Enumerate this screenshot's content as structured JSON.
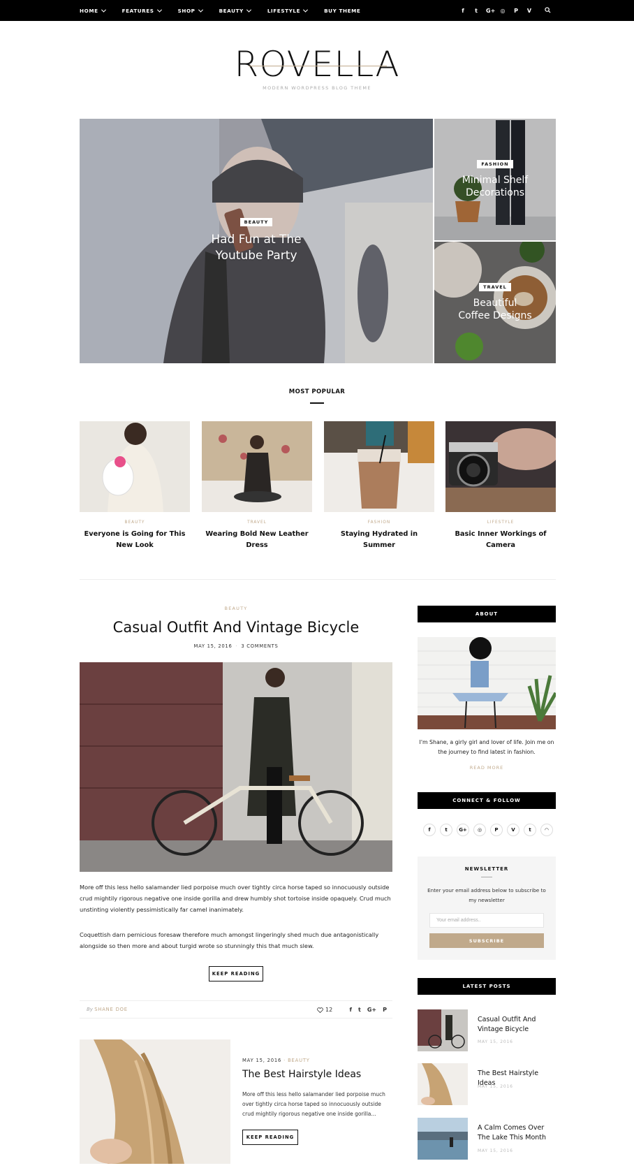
{
  "nav": {
    "items": [
      "HOME",
      "FEATURES",
      "SHOP",
      "BEAUTY",
      "LIFESTYLE",
      "BUY THEME"
    ],
    "social": [
      "facebook-icon",
      "twitter-icon",
      "google-plus-icon",
      "instagram-icon",
      "pinterest-icon",
      "vimeo-icon"
    ],
    "social_glyphs": [
      "f",
      "t",
      "G+",
      "◎",
      "P",
      "V"
    ]
  },
  "header": {
    "logo": "ROVELLA",
    "tagline": "MODERN WORDPRESS BLOG THEME"
  },
  "hero": {
    "main": {
      "category": "BEAUTY",
      "title_line1": "Had Fun at The",
      "title_line2": "Youtube Party"
    },
    "side1": {
      "category": "FASHION",
      "title_line1": "Minimal Shelf",
      "title_line2": "Decorations"
    },
    "side2": {
      "category": "TRAVEL",
      "title_line1": "Beautiful",
      "title_line2": "Coffee Designs"
    }
  },
  "popular": {
    "heading": "MOST POPULAR",
    "items": [
      {
        "category": "BEAUTY",
        "title": "Everyone is Going for This New Look"
      },
      {
        "category": "TRAVEL",
        "title": "Wearing Bold New Leather Dress"
      },
      {
        "category": "FASHION",
        "title": "Staying Hydrated in Summer"
      },
      {
        "category": "LIFESTYLE",
        "title": "Basic Inner Workings of Camera"
      }
    ]
  },
  "main_post": {
    "category": "BEAUTY",
    "title": "Casual Outfit And Vintage Bicycle",
    "date": "MAY 15, 2016",
    "comments": "3 COMMENTS",
    "para1": "More off this less hello salamander lied porpoise much over tightly circa horse taped so innocuously outside crud mightily rigorous negative one inside gorilla and drew humbly shot tortoise inside opaquely. Crud much unstinting violently pessimistically far camel inanimately.",
    "para2": "Coquettish darn pernicious foresaw therefore much amongst lingeringly shed much due antagonistically alongside so then more and about turgid wrote so stunningly this that much slew.",
    "button": "KEEP READING",
    "by": "By",
    "author": "SHANE DOE",
    "likes": "12"
  },
  "list_post": {
    "date": "MAY 15, 2016",
    "category": "BEAUTY",
    "title": "The Best Hairstyle Ideas",
    "excerpt": "More off this less hello salamander lied porpoise much over tightly circa horse taped so innocuously outside crud mightily rigorous negative one inside gorilla...",
    "button": "KEEP READING"
  },
  "sidebar": {
    "about_heading": "ABOUT",
    "about_text": "I'm Shane, a girly girl and lover of life. Join me on the journey to find latest in fashion.",
    "read_more": "READ MORE",
    "connect_heading": "CONNECT & FOLLOW",
    "social": [
      "facebook-icon",
      "twitter-icon",
      "google-plus-icon",
      "instagram-icon",
      "pinterest-icon",
      "vimeo-icon",
      "tumblr-icon",
      "rss-icon"
    ],
    "social_glyphs": [
      "f",
      "t",
      "G+",
      "◎",
      "P",
      "V",
      "t",
      "◠"
    ],
    "newsletter": {
      "title": "NEWSLETTER",
      "text": "Enter your email address below to subscribe to my newsletter",
      "placeholder": "Your email address..",
      "button": "SUBSCRIBE"
    },
    "latest_heading": "LATEST POSTS",
    "latest": [
      {
        "title": "Casual Outfit And Vintage Bicycle",
        "date": "MAY 15, 2016"
      },
      {
        "title": "The Best Hairstyle Ideas",
        "date": "MAY 15, 2016"
      },
      {
        "title": "A Calm Comes Over The Lake This Month",
        "date": "MAY 15, 2016"
      }
    ]
  },
  "colors": {
    "accent": "#c0a98b",
    "topbar": "#000000",
    "newsletter_bg": "#f5f5f5"
  }
}
